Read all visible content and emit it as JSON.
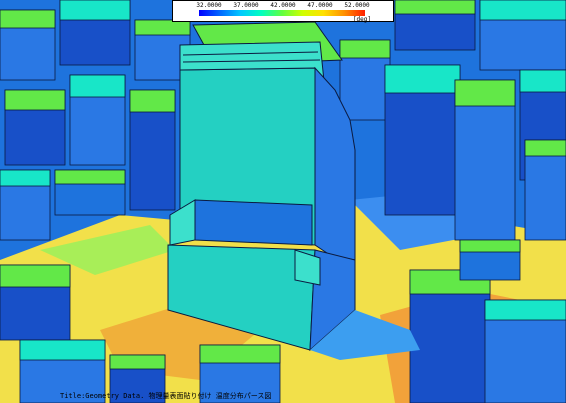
{
  "legend": {
    "ticks": [
      "32.0000",
      "37.0000",
      "42.0000",
      "47.0000",
      "52.0000"
    ],
    "unit": "[deg]",
    "colors": [
      "#0000ff",
      "#0066ff",
      "#00c8ff",
      "#00ffc0",
      "#60ff40",
      "#d0ff00",
      "#ffe000",
      "#ff9000",
      "#ff2000"
    ]
  },
  "footer": {
    "title": "Title:Geometry Data. 物理量表面貼り付け 温度分布パース図"
  },
  "palette": {
    "ground_yellow": "#f2e04a",
    "ground_orange": "#f2a23a",
    "ground_green": "#a8ee58",
    "roof_green": "#62e848",
    "roof_teal": "#18e6c8",
    "wall_blue": "#2a78e4",
    "wall_deep": "#1850c8",
    "tower_face": "#24d0c2",
    "tower_light": "#3ce0cc",
    "outline": "#0a1a40"
  }
}
